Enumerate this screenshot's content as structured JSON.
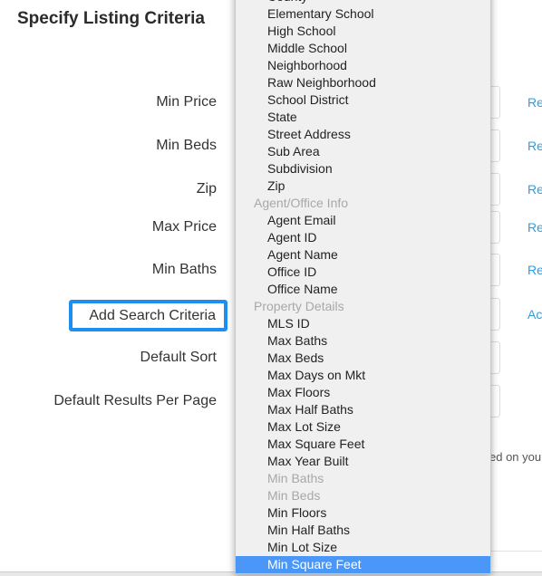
{
  "title": "Specify Listing Criteria",
  "rows": [
    {
      "label": "Min Price",
      "link": "Re"
    },
    {
      "label": "Min Beds",
      "link": "Re"
    },
    {
      "label": "Zip",
      "link": "Re"
    },
    {
      "label": "Max Price",
      "link": "Re"
    },
    {
      "label": "Min Baths",
      "link": "Re"
    },
    {
      "label": "Add Search Criteria",
      "link": "Ac"
    },
    {
      "label": "Default Sort",
      "link": ""
    },
    {
      "label": "Default Results Per Page",
      "link": ""
    }
  ],
  "note": "ed on you",
  "accent": "#1e8ff0",
  "menu": [
    {
      "label": "County",
      "type": "item"
    },
    {
      "label": "Elementary School",
      "type": "item"
    },
    {
      "label": "High School",
      "type": "item"
    },
    {
      "label": "Middle School",
      "type": "item"
    },
    {
      "label": "Neighborhood",
      "type": "item"
    },
    {
      "label": "Raw Neighborhood",
      "type": "item"
    },
    {
      "label": "School District",
      "type": "item"
    },
    {
      "label": "State",
      "type": "item"
    },
    {
      "label": "Street Address",
      "type": "item"
    },
    {
      "label": "Sub Area",
      "type": "item"
    },
    {
      "label": "Subdivision",
      "type": "item"
    },
    {
      "label": "Zip",
      "type": "item"
    },
    {
      "label": "Agent/Office Info",
      "type": "group"
    },
    {
      "label": "Agent Email",
      "type": "item"
    },
    {
      "label": "Agent ID",
      "type": "item"
    },
    {
      "label": "Agent Name",
      "type": "item"
    },
    {
      "label": "Office ID",
      "type": "item"
    },
    {
      "label": "Office Name",
      "type": "item"
    },
    {
      "label": "Property Details",
      "type": "group"
    },
    {
      "label": "MLS ID",
      "type": "item"
    },
    {
      "label": "Max Baths",
      "type": "item"
    },
    {
      "label": "Max Beds",
      "type": "item"
    },
    {
      "label": "Max Days on Mkt",
      "type": "item"
    },
    {
      "label": "Max Floors",
      "type": "item"
    },
    {
      "label": "Max Half Baths",
      "type": "item"
    },
    {
      "label": "Max Lot Size",
      "type": "item"
    },
    {
      "label": "Max Square Feet",
      "type": "item"
    },
    {
      "label": "Max Year Built",
      "type": "item"
    },
    {
      "label": "Min Baths",
      "type": "disabled"
    },
    {
      "label": "Min Beds",
      "type": "disabled"
    },
    {
      "label": "Min Floors",
      "type": "item"
    },
    {
      "label": "Min Half Baths",
      "type": "item"
    },
    {
      "label": "Min Lot Size",
      "type": "item"
    },
    {
      "label": "Min Square Feet",
      "type": "selected"
    }
  ]
}
